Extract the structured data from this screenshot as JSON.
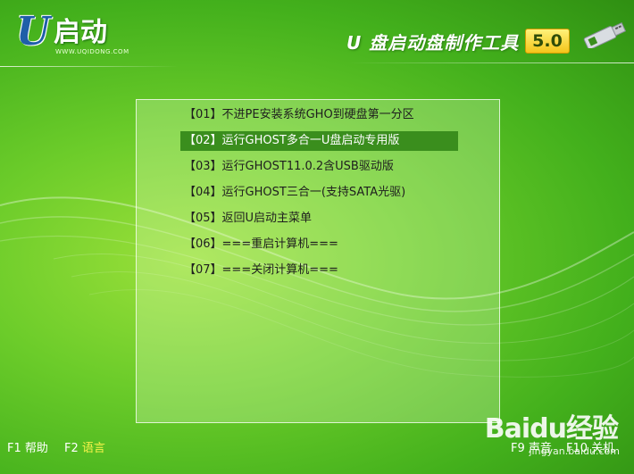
{
  "header": {
    "logo_letter": "U",
    "logo_text": "启动",
    "logo_url": "WWW.UQIDONG.COM",
    "title": "U 盘启动盘制作工具",
    "version": "5.0"
  },
  "menu": {
    "items": [
      {
        "label": "【01】不进PE安装系统GHO到硬盘第一分区"
      },
      {
        "label": "【02】运行GHOST多合一U盘启动专用版"
      },
      {
        "label": "【03】运行GHOST11.0.2含USB驱动版"
      },
      {
        "label": "【04】运行GHOST三合一(支持SATA光驱)"
      },
      {
        "label": "【05】返回U启动主菜单"
      },
      {
        "label": "【06】===重启计算机==="
      },
      {
        "label": "【07】===关闭计算机==="
      }
    ],
    "selected_index": 1
  },
  "footer": {
    "f1_key": "F1",
    "f1_label": "帮助",
    "f2_key": "F2",
    "f2_label": "语言",
    "f9_key": "F9",
    "f9_label": "声音",
    "f10_key": "F10",
    "f10_label": "关机"
  },
  "watermark": {
    "brand": "Baidu经验",
    "url": "jingyan.baidu.com"
  },
  "colors": {
    "selected_bg": "#3a8e1d",
    "accent_yellow": "#f7f34a",
    "version_bg": "#f4c51a"
  }
}
